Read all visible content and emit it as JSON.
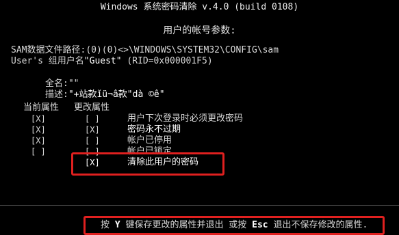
{
  "window": {
    "title": "Windows 系统密码清除 v.4.0 (build 0108)"
  },
  "heading": "用户的帐号参数:",
  "sam_path": {
    "label": "SAM数据文件路径:",
    "value": "(0)(0)<>\\WINDOWS\\SYSTEM32\\CONFIG\\sam"
  },
  "user": {
    "label": "User's 组用户名",
    "name": "\"Guest\"",
    "rid": "(RID=0x000001F5)"
  },
  "fields": {
    "fullname_label": "全名:",
    "fullname_value": "\"\"",
    "desc_label": "描述:",
    "desc_value": "\"+站款ǐü¬â款\"dà ©ê\""
  },
  "columns": {
    "current": "当前属性",
    "change": "更改属性"
  },
  "attributes": [
    {
      "current": "[X]",
      "change": "[ ]",
      "label": "用户下次登录时必须更改密码"
    },
    {
      "current": "[X]",
      "change": "[X]",
      "label": "密码永不过期"
    },
    {
      "current": "[X]",
      "change": "[ ]",
      "label": "帐户已停用"
    },
    {
      "current": "[ ]",
      "change": "[ ]",
      "label": "帐户已锁定"
    },
    {
      "current": "",
      "change": "[X]",
      "label": "清除此用户的密码"
    }
  ],
  "footer": {
    "prefix": "按 ",
    "key_save": "Y",
    "middle": " 键保存更改的属性并退出 或按 ",
    "key_esc": "Esc",
    "suffix": " 退出不保存修改的属性."
  },
  "colors": {
    "background": "#000000",
    "text": "#d8d8d8",
    "highlight_border": "#e0201f"
  }
}
